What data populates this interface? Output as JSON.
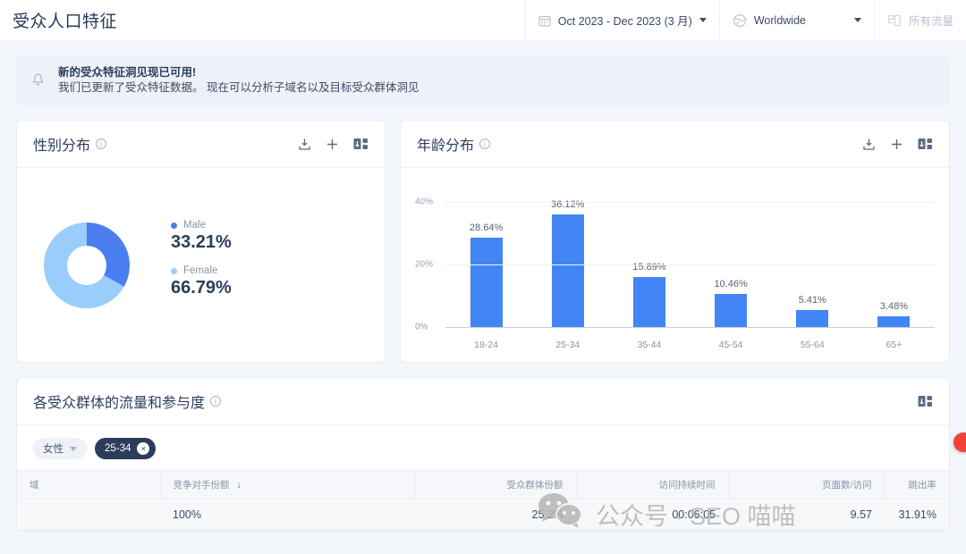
{
  "header": {
    "title": "受众人口特征",
    "date_range": "Oct 2023 - Dec 2023 (3 月)",
    "region": "Worldwide",
    "traffic": "所有流量",
    "calendar_icon": "calendar-icon",
    "globe_icon": "globe-icon",
    "device_icon": "device-icon"
  },
  "banner": {
    "bell_icon": "bell-icon",
    "title": "新的受众特征洞见现已可用!",
    "subtitle": "我们已更新了受众特征数据。 现在可以分析子域名以及目标受众群体洞见"
  },
  "gender_card": {
    "title": "性别分布",
    "info_icon": "info-icon",
    "actions": [
      "export-icon",
      "add-icon",
      "sort-icon"
    ]
  },
  "age_card": {
    "title": "年龄分布",
    "info_icon": "info-icon",
    "actions": [
      "export-icon",
      "add-icon",
      "sort-icon"
    ]
  },
  "audience_card": {
    "title": "各受众群体的流量和参与度",
    "info_icon": "info-icon",
    "sort_icon": "sort-icon",
    "filters": [
      {
        "label": "女性",
        "type": "dropdown"
      },
      {
        "label": "25-34",
        "type": "removable",
        "close": "×"
      }
    ],
    "columns": [
      {
        "label": "域",
        "align": "left"
      },
      {
        "label": "竞争对手份额",
        "align": "left",
        "sort": "↓"
      },
      {
        "label": "受众群体份额",
        "align": "right"
      },
      {
        "label": "访问持续时间",
        "align": "right"
      },
      {
        "label": "页面数/访问",
        "align": "right"
      },
      {
        "label": "跳出率",
        "align": "right"
      }
    ],
    "rows": [
      {
        "swatch_color": "#b35af8",
        "competitor_share": "100%",
        "competitor_share_pct": 100,
        "audience_share": "25.2%",
        "visit_duration": "00:06:05",
        "pages_per_visit": "9.57",
        "bounce_rate": "31.91%"
      }
    ]
  },
  "watermark": {
    "text": "公众号 · SEO 喵喵",
    "icon": "wechat-icon"
  },
  "chart_data": [
    {
      "type": "pie",
      "title": "性别分布",
      "labels": [
        "Male",
        "Female"
      ],
      "values": [
        33.21,
        66.79
      ],
      "value_labels": [
        "33.21%",
        "66.79%"
      ],
      "colors": [
        "#4a7ef0",
        "#9acdfa"
      ],
      "legend": "right",
      "donut": true
    },
    {
      "type": "bar",
      "title": "年龄分布",
      "categories": [
        "18-24",
        "25-34",
        "35-44",
        "45-54",
        "55-64",
        "65+"
      ],
      "values": [
        28.64,
        36.12,
        15.89,
        10.46,
        5.41,
        3.48
      ],
      "value_labels": [
        "28.64%",
        "36.12%",
        "15.89%",
        "10.46%",
        "5.41%",
        "3.48%"
      ],
      "ylabel": "",
      "xlabel": "",
      "ylim": [
        0,
        40
      ],
      "yticks": [
        "0%",
        "20%",
        "40%"
      ],
      "ytick_values": [
        0,
        20,
        40
      ],
      "color": "#4285f4",
      "grid": true
    }
  ]
}
